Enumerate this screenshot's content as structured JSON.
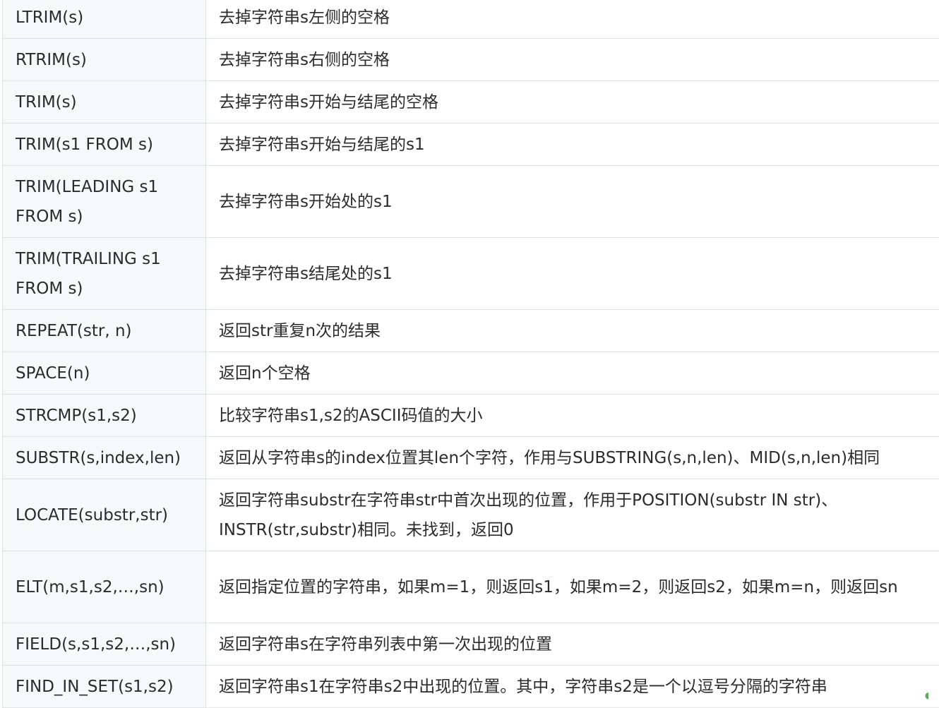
{
  "rows": [
    {
      "fn": "LTRIM(s)",
      "desc": "去掉字符串s左侧的空格"
    },
    {
      "fn": "RTRIM(s)",
      "desc": "去掉字符串s右侧的空格"
    },
    {
      "fn": "TRIM(s)",
      "desc": "去掉字符串s开始与结尾的空格"
    },
    {
      "fn": "TRIM(s1 FROM s)",
      "desc": "去掉字符串s开始与结尾的s1"
    },
    {
      "fn": "TRIM(LEADING s1 FROM s)",
      "desc": "去掉字符串s开始处的s1"
    },
    {
      "fn": "TRIM(TRAILING s1 FROM s)",
      "desc": "去掉字符串s结尾处的s1"
    },
    {
      "fn": "REPEAT(str, n)",
      "desc": "返回str重复n次的结果"
    },
    {
      "fn": "SPACE(n)",
      "desc": "返回n个空格"
    },
    {
      "fn": "STRCMP(s1,s2)",
      "desc": "比较字符串s1,s2的ASCII码值的大小"
    },
    {
      "fn": "SUBSTR(s,index,len)",
      "desc": "返回从字符串s的index位置其len个字符，作用与SUBSTRING(s,n,len)、MID(s,n,len)相同"
    },
    {
      "fn": "LOCATE(substr,str)",
      "desc": "返回字符串substr在字符串str中首次出现的位置，作用于POSITION(substr IN str)、INSTR(str,substr)相同。未找到，返回0"
    },
    {
      "fn": "ELT(m,s1,s2,…,sn)",
      "desc": "返回指定位置的字符串，如果m=1，则返回s1，如果m=2，则返回s2，如果m=n，则返回sn"
    },
    {
      "fn": "FIELD(s,s1,s2,…,sn)",
      "desc": "返回字符串s在字符串列表中第一次出现的位置"
    },
    {
      "fn": "FIND_IN_SET(s1,s2)",
      "desc": "返回字符串s1在字符串s2中出现的位置。其中，字符串s2是一个以逗号分隔的字符串"
    }
  ]
}
